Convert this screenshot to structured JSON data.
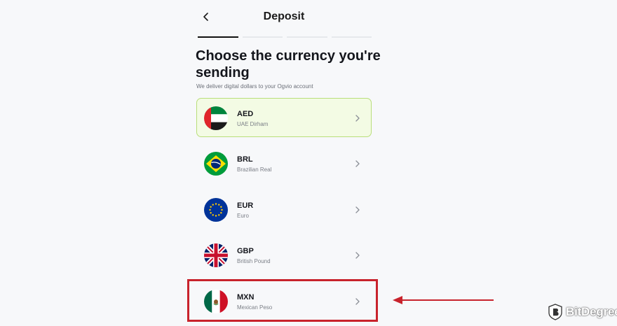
{
  "header": {
    "title": "Deposit",
    "back_icon": "chevron-left-icon"
  },
  "progress": {
    "total_steps": 4,
    "current_step": 1
  },
  "main": {
    "heading": "Choose the currency you're sending",
    "subtitle": "We deliver digital dollars to your Ogvio account"
  },
  "currencies": [
    {
      "code": "AED",
      "name": "UAE Dirham",
      "flag": "uae-flag-icon",
      "selected": true
    },
    {
      "code": "BRL",
      "name": "Brazilian Real",
      "flag": "brazil-flag-icon",
      "selected": false
    },
    {
      "code": "EUR",
      "name": "Euro",
      "flag": "eu-flag-icon",
      "selected": false
    },
    {
      "code": "GBP",
      "name": "British Pound",
      "flag": "uk-flag-icon",
      "selected": false
    },
    {
      "code": "MXN",
      "name": "Mexican Peso",
      "flag": "mexico-flag-icon",
      "selected": false
    }
  ],
  "annotation": {
    "highlight_color": "#c8232c",
    "highlighted_item": "MXN"
  },
  "watermark": {
    "text": "BitDegree"
  },
  "colors": {
    "selected_bg": "#f3fbe4",
    "selected_border": "#b9de7a",
    "background": "#f7f8fa"
  }
}
